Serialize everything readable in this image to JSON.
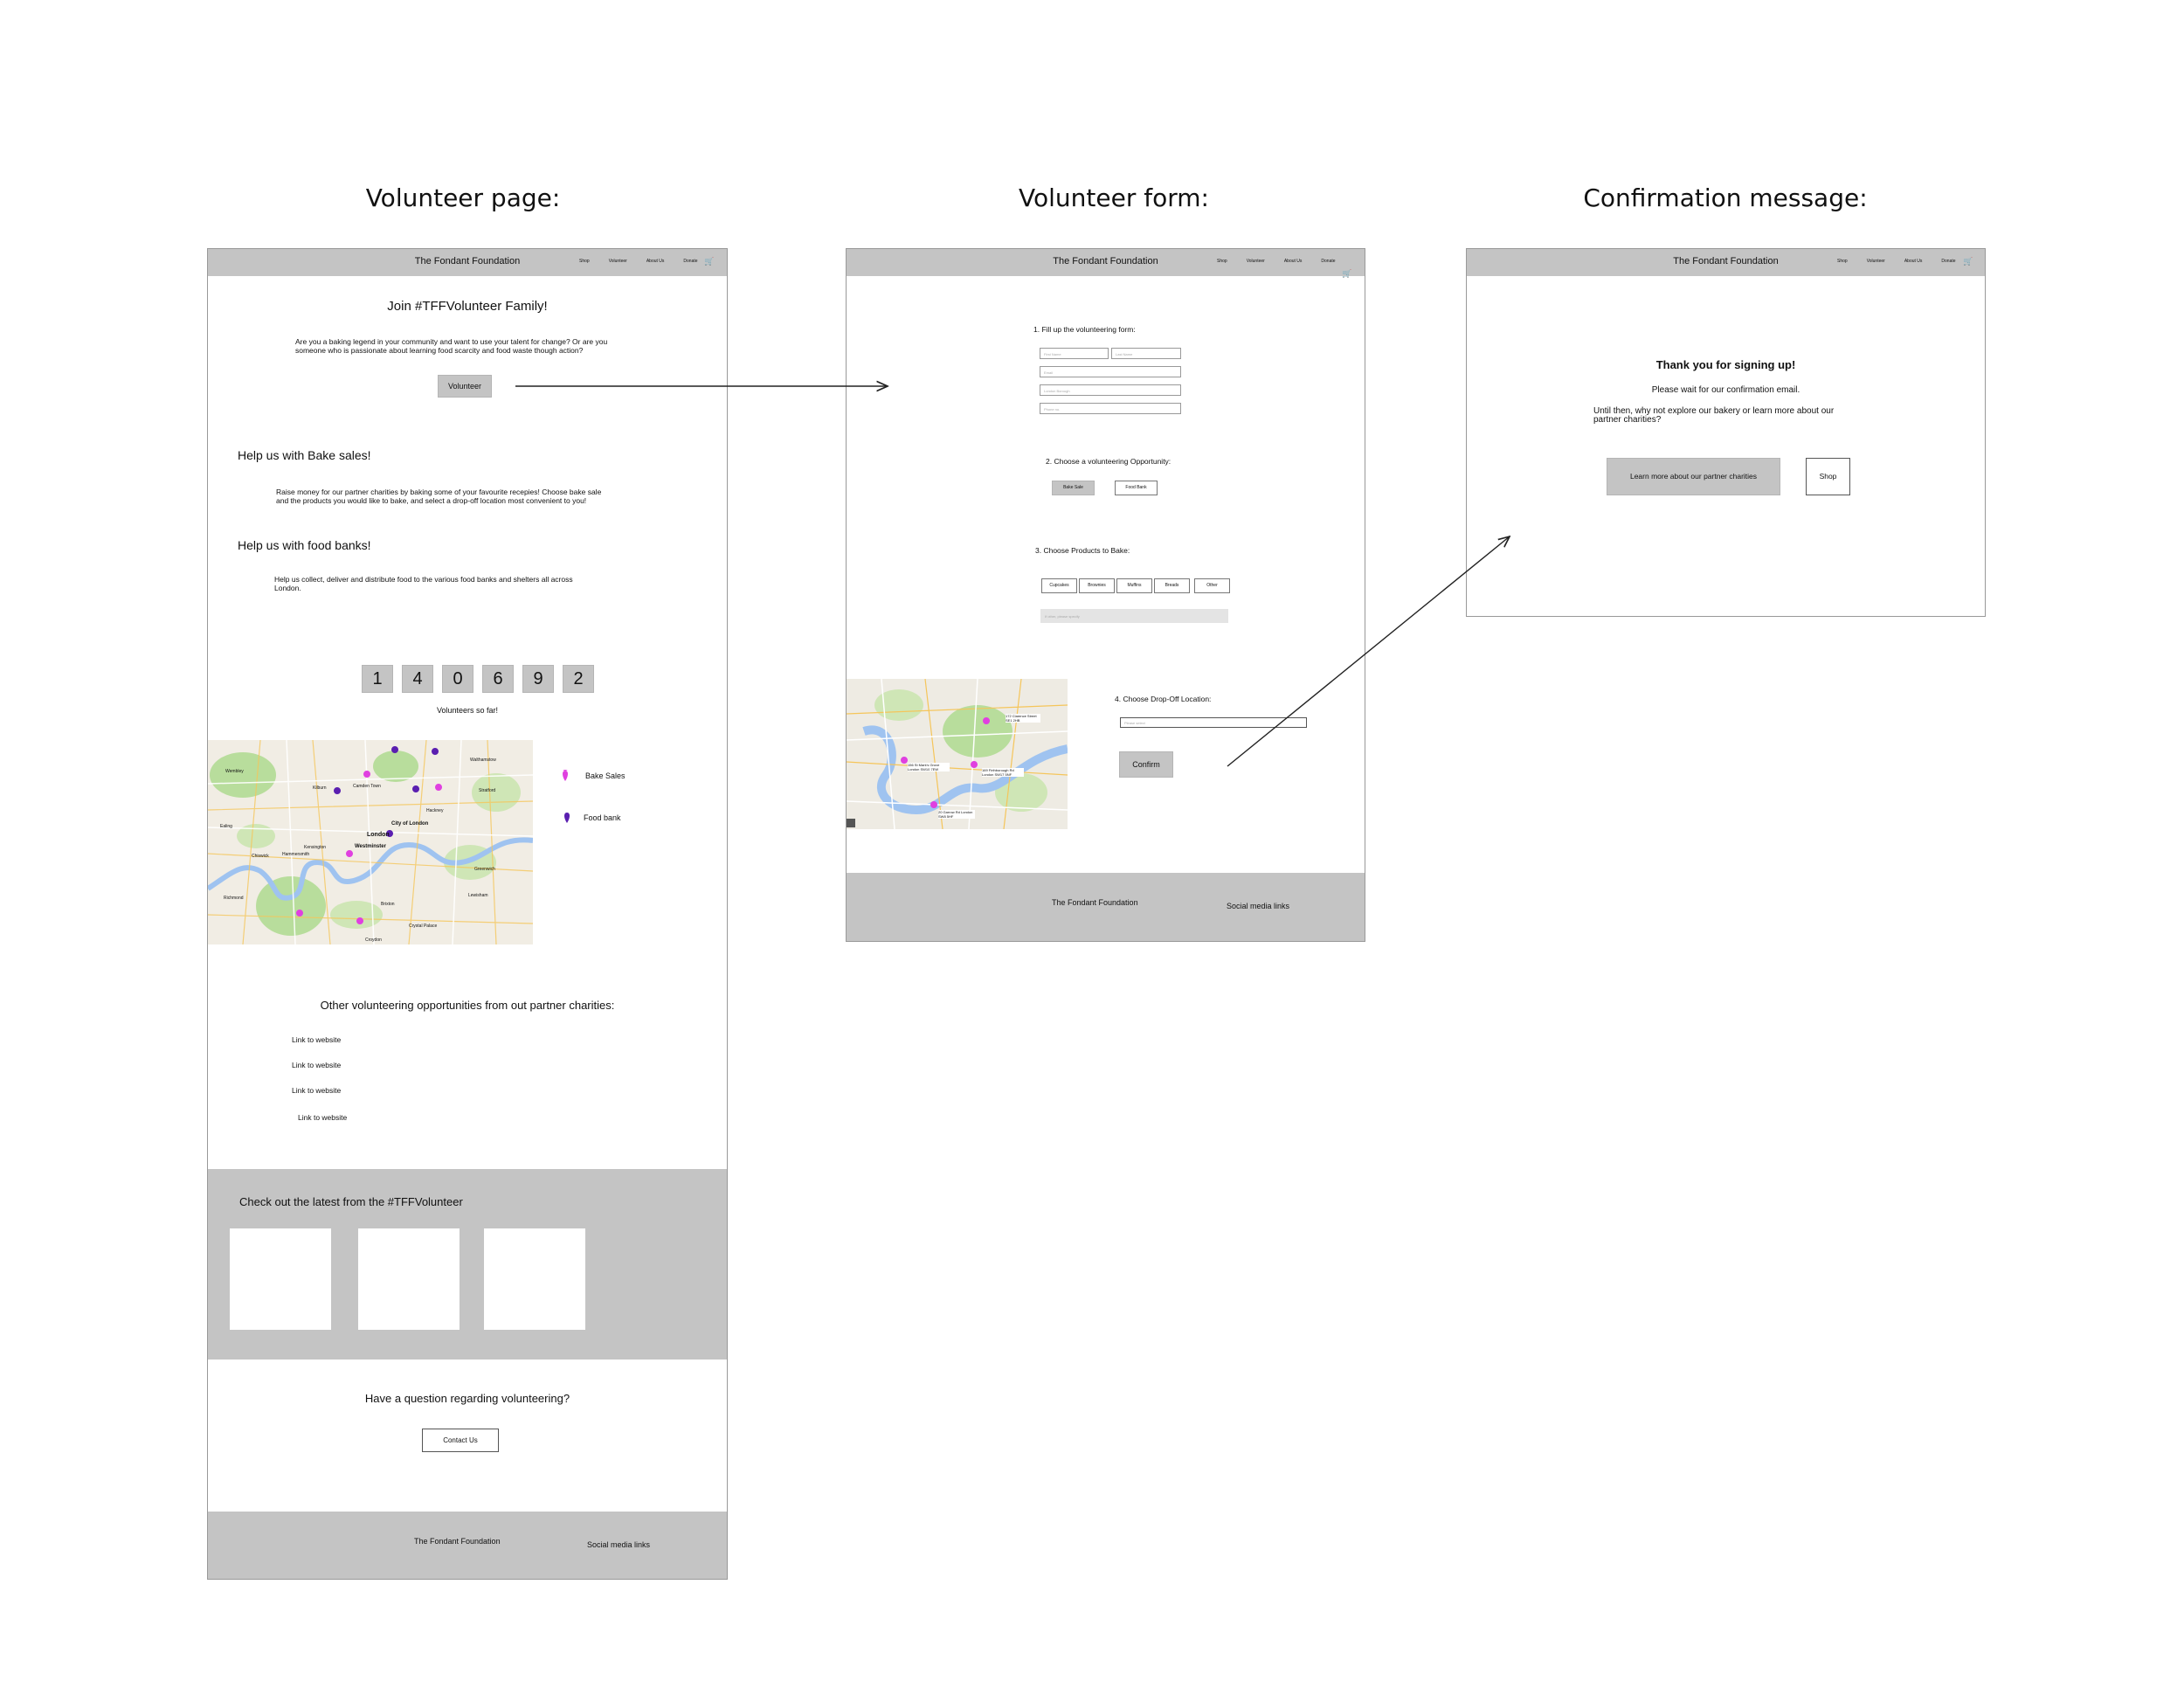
{
  "headings": {
    "volunteer_page": "Volunteer page:",
    "volunteer_form": "Volunteer form:",
    "confirmation": "Confirmation message:"
  },
  "nav": {
    "brand": "The Fondant Foundation",
    "links": [
      "Shop",
      "Volunteer",
      "About Us",
      "Donate"
    ],
    "cart_icon": "cart-icon"
  },
  "page1": {
    "title": "Join #TFFVolunteer Family!",
    "intro_line1": "Are you a baking legend in your community and want to use your talent for change? Or are you",
    "intro_line2": "someone who is passionate about learning food scarcity and food waste though action?",
    "volunteer_button": "Volunteer",
    "bake_heading": "Help us with Bake sales!",
    "bake_text_line1": "Raise money for our partner charities by baking some of your favourite recepies!  Choose bake sale",
    "bake_text_line2": "and the products you would like to bake, and select a drop-off location most convenient to you!",
    "food_heading": "Help us with food banks!",
    "food_text_line1": "Help us collect, deliver and distribute food to the various food banks and shelters all across",
    "food_text_line2": "London.",
    "counter_digits": [
      "1",
      "4",
      "0",
      "6",
      "9",
      "2"
    ],
    "counter_label": "Volunteers so far!",
    "map_labels": [
      "City of London",
      "London",
      "Westminster",
      "Camden Town",
      "Wembley",
      "Ealing",
      "Kensington",
      "Chiswick",
      "Hammersmith",
      "Richmond",
      "Brixton",
      "Greenwich",
      "Lewisham",
      "Stratford",
      "Kilburn",
      "Hackney",
      "Walthamstow",
      "Crystal Palace",
      "Croydon"
    ],
    "legend": [
      {
        "label": "Bake Sales",
        "color": "#e040e0"
      },
      {
        "label": "Food bank",
        "color": "#5a1fb0"
      }
    ],
    "other_heading": "Other volunteering opportunities from out partner charities:",
    "links": [
      "Link to website",
      "Link to website",
      "Link to website",
      "Link to website"
    ],
    "latest_heading": "Check out the latest from the #TFFVolunteer",
    "question_heading": "Have a question regarding volunteering?",
    "contact_button": "Contact Us",
    "footer_brand": "The Fondant Foundation",
    "footer_social": "Social media links"
  },
  "page2": {
    "step1": "1. Fill up the volunteering form:",
    "fields": {
      "first_name": "First Name",
      "last_name": "Last Name",
      "email": "Email",
      "borough": "London Borough",
      "phone": "Phone no."
    },
    "step2": "2. Choose a volunteering Opportunity:",
    "opp_bake": "Bake Sale",
    "opp_food": "Food Bank",
    "step3": "3. Choose Products to Bake:",
    "products": [
      "Cupcakes",
      "Brownies",
      "Muffins",
      "Breads",
      "Other"
    ],
    "other_placeholder": "If other, please specify",
    "step4": "4. Choose Drop-Off Location:",
    "location_placeholder": "Please select",
    "confirm_button": "Confirm",
    "map_addresses": [
      "172 Clarence Street SE1 2HB",
      "156 St Mark's Grove London SW10 7EW",
      "169 Firthborough Rd London SW17 5NF",
      "20 Garrow Rd London SW8 5HF"
    ],
    "footer_brand": "The Fondant Foundation",
    "footer_social": "Social media links"
  },
  "page3": {
    "thanks": "Thank you for signing up!",
    "wait": "Please wait for our confirmation email.",
    "explore_line1": "Until then, why not explore our bakery or learn more about our",
    "explore_line2": "partner charities?",
    "learn_button": "Learn  more about our partner charities",
    "shop_button": "Shop"
  },
  "colors": {
    "nav_gray": "#c4c4c4",
    "bake_pin": "#e040e0",
    "food_pin": "#5a1fb0",
    "water": "#9fc3f0",
    "park": "#b8dd9c"
  }
}
